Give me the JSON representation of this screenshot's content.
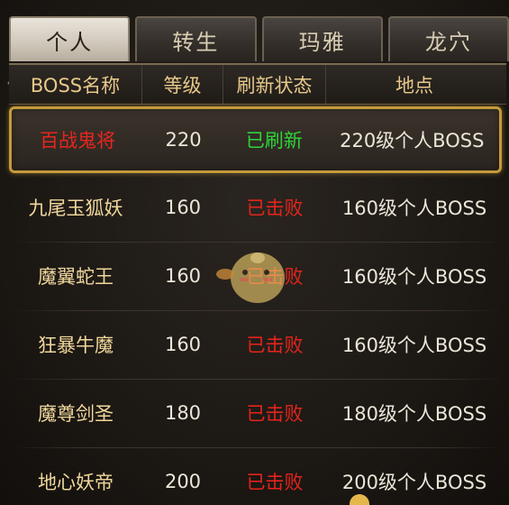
{
  "tabs": [
    "个人",
    "转生",
    "玛雅",
    "龙穴"
  ],
  "active_tab": 0,
  "headers": {
    "name": "BOSS名称",
    "level": "等级",
    "status": "刷新状态",
    "location": "地点"
  },
  "rows": [
    {
      "name": "百战鬼将",
      "level": "220",
      "status": "已刷新",
      "location": "220级个人BOSS"
    },
    {
      "name": "九尾玉狐妖",
      "level": "160",
      "status": "已击败",
      "location": "160级个人BOSS"
    },
    {
      "name": "魔翼蛇王",
      "level": "160",
      "status": "已击败",
      "location": "160级个人BOSS"
    },
    {
      "name": "狂暴牛魔",
      "level": "160",
      "status": "已击败",
      "location": "160级个人BOSS"
    },
    {
      "name": "魔尊剑圣",
      "level": "180",
      "status": "已击败",
      "location": "180级个人BOSS"
    },
    {
      "name": "地心妖帝",
      "level": "200",
      "status": "已击败",
      "location": "200级个人BOSS"
    }
  ],
  "colors": {
    "refreshed": "#2ed33a",
    "defeated": "#e4241c",
    "selected_name": "#e6261f",
    "name": "#f0d79c",
    "header_text": "#e8c98a",
    "selected_border": "#c49a3a"
  },
  "icons": {
    "mascot": "chick-mascot-icon",
    "corner": "ornament-corner-icon"
  }
}
